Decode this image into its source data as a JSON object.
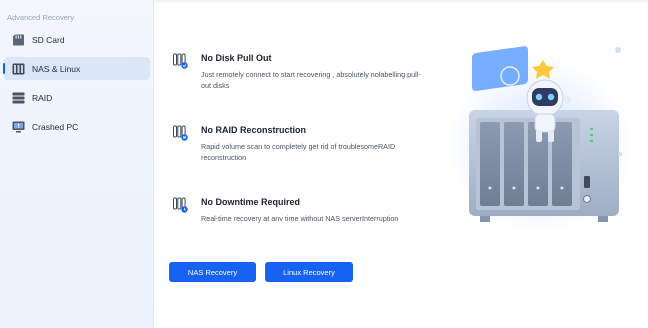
{
  "sidebar": {
    "section_label": "Advanced Recovery",
    "items": [
      {
        "label": "SD Card",
        "icon": "sd-card-icon"
      },
      {
        "label": "NAS & Linux",
        "icon": "nas-icon",
        "active": true
      },
      {
        "label": "RAID",
        "icon": "raid-icon"
      },
      {
        "label": "Crashed PC",
        "icon": "crashed-pc-icon"
      }
    ]
  },
  "features": [
    {
      "title": "No Disk Pull Out",
      "description": "Just remotely connect to start recovering , absolutely nolabelling pull-out disks",
      "icon": "drives-check-icon"
    },
    {
      "title": "No RAID Reconstruction",
      "description": "Rapid volume scan to completely get rid of troublesomeRAID reconstruction",
      "icon": "drives-x-icon"
    },
    {
      "title": "No Downtime Required",
      "description": "Real-time recovery at anv time without NAS serverInterruption",
      "icon": "drives-clock-icon"
    }
  ],
  "buttons": {
    "nas_recovery": "NAS Recovery",
    "linux_recovery": "Linux Recovery"
  },
  "colors": {
    "accent": "#1762f0",
    "sidebar_bg": "#eef3fa",
    "active_item_bg": "#dbe7f7"
  },
  "illustration": "nas-server-with-robot-mascot"
}
